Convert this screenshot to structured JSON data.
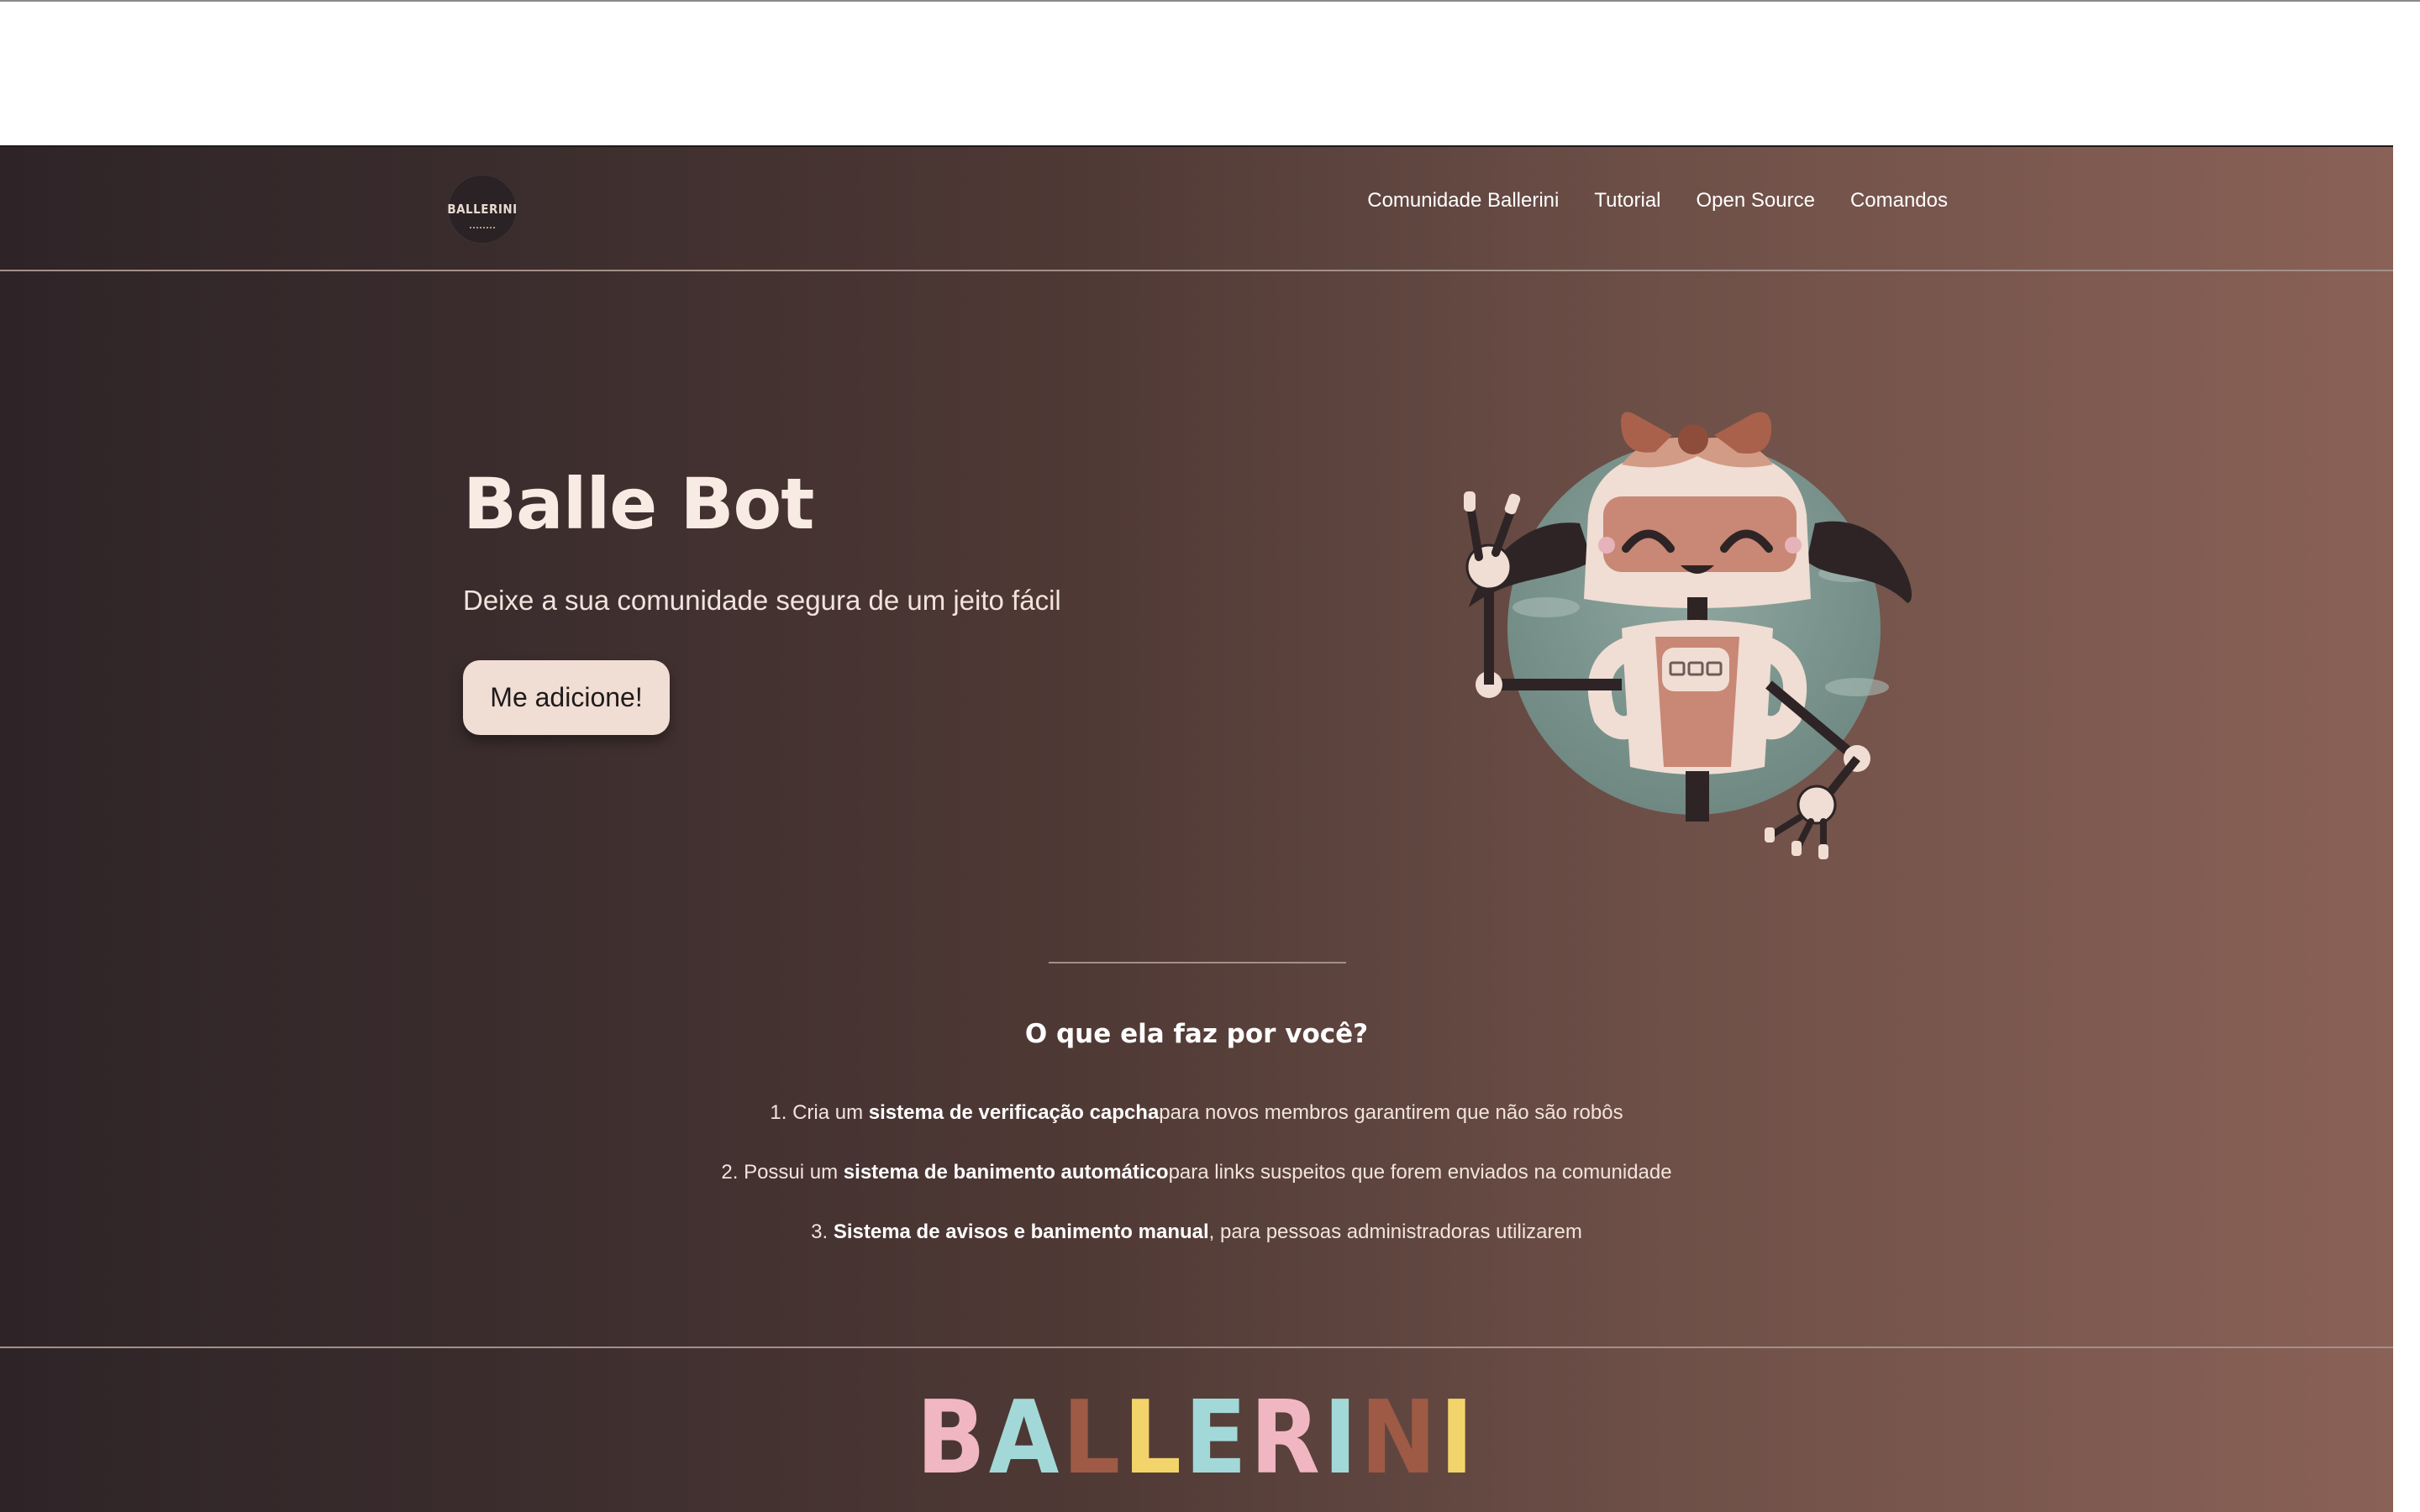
{
  "header": {
    "logo_text": "BALLERINI",
    "nav": [
      {
        "label": "Comunidade Ballerini"
      },
      {
        "label": "Tutorial"
      },
      {
        "label": "Open Source"
      },
      {
        "label": "Comandos"
      }
    ]
  },
  "hero": {
    "title": "Balle Bot",
    "subtitle": "Deixe a sua comunidade segura de um jeito fácil",
    "cta_label": "Me adicione!"
  },
  "features": {
    "title": "O que ela faz por você?",
    "items": [
      {
        "prefix": "1. Cria um ",
        "bold": "sistema de verificação capcha",
        "suffix": "para novos membros garantirem que não são robôs"
      },
      {
        "prefix": "2. Possui um ",
        "bold": "sistema de banimento automático",
        "suffix": "para links suspeitos que forem enviados na comunidade"
      },
      {
        "prefix": "3. ",
        "bold": "Sistema de avisos e banimento manual",
        "suffix": ", para pessoas administradoras utilizarem"
      }
    ]
  },
  "footer": {
    "brand_letters": [
      "B",
      "A",
      "L",
      "L",
      "E",
      "R",
      "I",
      "N",
      "I"
    ]
  },
  "colors": {
    "bg_dark": "#2e2424",
    "bg_light": "#8a6156",
    "cta_bg": "#f0ddd3",
    "text": "#f1e4dc"
  },
  "icons": {
    "logo": "ballerini-logo-icon",
    "robot": "balle-bot-robot-icon"
  }
}
